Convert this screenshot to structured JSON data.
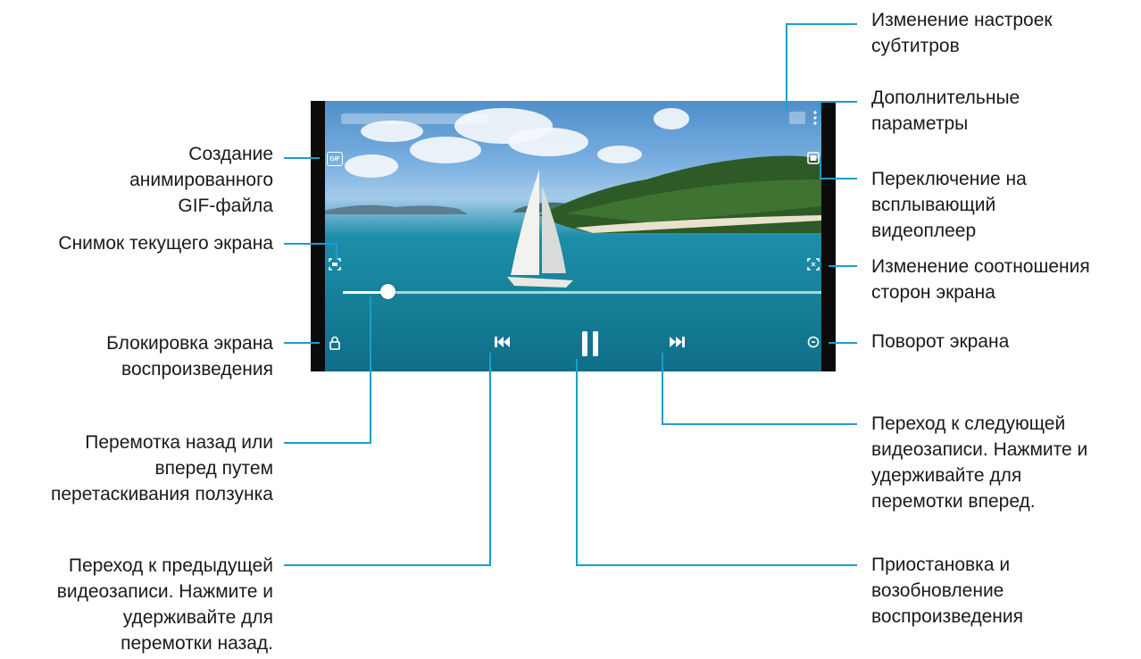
{
  "callouts": {
    "subtitle_settings": [
      "Изменение настроек",
      "субтитров"
    ],
    "more_options": [
      "Дополнительные",
      "параметры"
    ],
    "create_gif": [
      "Создание",
      "анимированного",
      "GIF-файла"
    ],
    "popup_player": [
      "Переключение на",
      "всплывающий",
      "видеоплеер"
    ],
    "screenshot": [
      "Снимок текущего экрана"
    ],
    "aspect_ratio": [
      "Изменение соотношения",
      "сторон экрана"
    ],
    "lock_screen": [
      "Блокировка экрана",
      "воспроизведения"
    ],
    "rotate_screen": [
      "Поворот экрана"
    ],
    "seek": [
      "Перемотка назад или",
      "вперед путем",
      "перетаскивания ползунка"
    ],
    "next_video": [
      "Переход к следующей",
      "видеозаписи. Нажмите и",
      "удерживайте для",
      "перемотки вперед."
    ],
    "previous_video": [
      "Переход к предыдущей",
      "видеозаписи. Нажмите и",
      "удерживайте для",
      "перемотки назад."
    ],
    "pause_resume": [
      "Приостановка и",
      "возобновление",
      "воспроизведения"
    ]
  },
  "player": {
    "gif_icon_text": "GIF",
    "playback_progress": 0.09,
    "icons": {
      "gif": "gif-icon",
      "screenshot": "screenshot-capture-icon",
      "lock": "lock-icon",
      "popup": "popup-player-icon",
      "aspect": "aspect-ratio-icon",
      "rotate": "rotate-icon",
      "more": "more-vertical-icon",
      "subtitle": "subtitle-settings-icon",
      "previous": "skip-previous-icon",
      "pause": "pause-icon",
      "next": "skip-next-icon"
    }
  },
  "colors": {
    "leader": "#1e9dc9",
    "text": "#1a1a1a"
  }
}
